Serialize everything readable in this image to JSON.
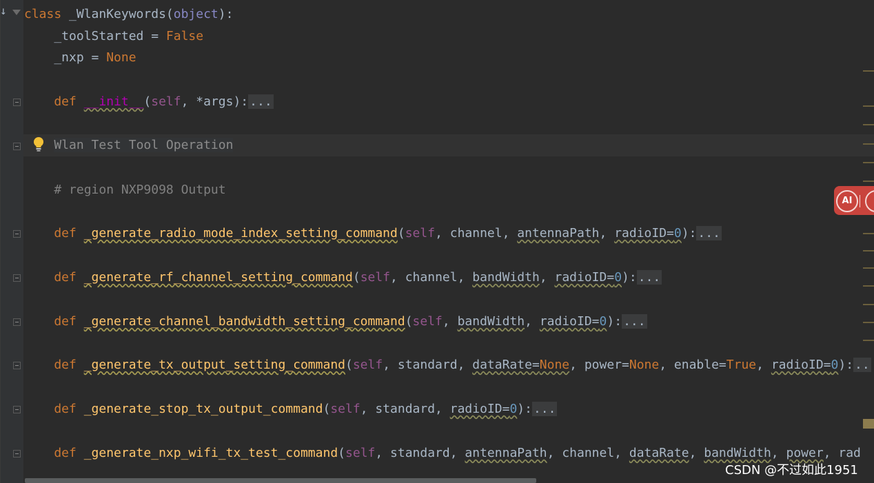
{
  "editor": {
    "lines": {
      "class_kw": "class",
      "class_name": " _WlanKeywords",
      "class_open": "(",
      "class_base": "object",
      "class_close": "):",
      "tool_started_name": "    _toolStarted = ",
      "tool_started_value": "False",
      "nxp_name": "    _nxp = ",
      "nxp_value": "None",
      "init": {
        "def": "    def ",
        "name": "__init__",
        "open": "(",
        "self": "self",
        "rest": ", *args):",
        "dots": "..."
      },
      "region_title": "Wlan Test Tool Operation",
      "region_comment": "    # region NXP9098 Output",
      "radio_mode": {
        "def": "    def ",
        "name": "_generate_radio_mode_index_setting_command",
        "open": "(",
        "self": "self",
        "p1": ", channel, ",
        "p2": "antennaPath",
        "p3": ", ",
        "p4": "radioID=",
        "p4v": "0",
        "close": "):",
        "dots": "..."
      },
      "rf_channel": {
        "def": "    def ",
        "name": "_generate_rf_channel_setting_command",
        "open": "(",
        "self": "self",
        "p1": ", channel, ",
        "p2": "bandWidth",
        "p3": ", ",
        "p4": "radioID=",
        "p4v": "0",
        "close": "):",
        "dots": "..."
      },
      "bandwidth": {
        "def": "    def ",
        "name": "_generate_channel_bandwidth_setting_command",
        "open": "(",
        "self": "self",
        "p1": ", ",
        "p2": "bandWidth",
        "p3": ", ",
        "p4": "radioID=",
        "p4v": "0",
        "close": "):",
        "dots": "..."
      },
      "tx_output": {
        "def": "    def ",
        "name": "_generate_tx_output_setting_command",
        "open": "(",
        "self": "self",
        "p1": ", standard, ",
        "p2": "dataRate=",
        "p2v": "None",
        "p3": ", power=",
        "p3v": "None",
        "p4": ", enable=",
        "p4v": "True",
        "p5": ", ",
        "p6": "radioID=",
        "p6v": "0",
        "close": "):",
        "dots": ".."
      },
      "stop_tx": {
        "def": "    def ",
        "name": "_generate_stop_tx_output_command",
        "open": "(",
        "self": "self",
        "p1": ", standard, ",
        "p2": "radioID=",
        "p2v": "0",
        "close": "):",
        "dots": "..."
      },
      "nxp_wifi": {
        "def": "    def ",
        "name": "_generate_nxp_wifi_tx_test_command",
        "open": "(",
        "self": "self",
        "p1": ", standard, ",
        "p2": "antennaPath",
        "p3": ", channel, ",
        "p4": "dataRate",
        "p5": ", ",
        "p6": "bandWidth",
        "p7": ", ",
        "p8": "power",
        "p9": ", ",
        "p10": "rad"
      }
    }
  },
  "ai_button": {
    "label": "AI"
  },
  "watermark": "CSDN @不过如此1951",
  "icons": {
    "bulb": "lightbulb-icon",
    "fold": "fold-icon",
    "arrow": "down-arrow-icon"
  }
}
